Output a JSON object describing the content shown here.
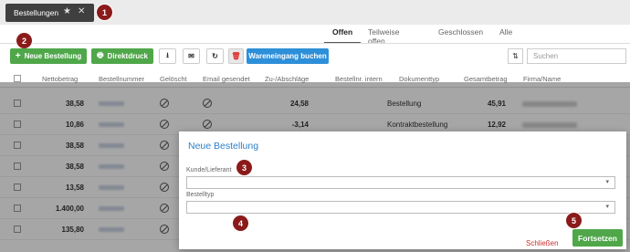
{
  "window": {
    "tab_label": "Bestellungen",
    "star": "★",
    "close": "✕"
  },
  "badges": [
    "1",
    "2",
    "3",
    "4",
    "5"
  ],
  "view_tabs": [
    "Offen",
    "Teilweise offen",
    "Geschlossen",
    "Alle"
  ],
  "toolbar": {
    "new_order": "Neue Bestellung",
    "direct_print": "Direktdruck",
    "goods_receipt": "Wareneingang buchen",
    "search_placeholder": "Suchen"
  },
  "table": {
    "headers": [
      "Nettobetrag",
      "Bestellnummer",
      "Gelöscht",
      "Email gesendet",
      "Zu-/Abschläge",
      "Bestellnr. intern",
      "Dokumenttyp",
      "Gesamtbetrag",
      "Firma/Name"
    ],
    "rows": [
      {
        "netto": "38,58",
        "zu": "24,58",
        "typ": "Bestellung",
        "gesamt": "45,91"
      },
      {
        "netto": "10,86",
        "zu": "-3,14",
        "typ": "Kontraktbestellung",
        "gesamt": "12,92"
      },
      {
        "netto": "38,58",
        "zu": "",
        "typ": "",
        "gesamt": ""
      },
      {
        "netto": "38,58",
        "zu": "",
        "typ": "",
        "gesamt": ""
      },
      {
        "netto": "13,58",
        "zu": "",
        "typ": "",
        "gesamt": ""
      },
      {
        "netto": "1.400,00",
        "zu": "",
        "typ": "",
        "gesamt": ""
      },
      {
        "netto": "135,80",
        "zu": "",
        "typ": "",
        "gesamt": ""
      }
    ]
  },
  "modal": {
    "title": "Neue Bestellung",
    "field1_label": "Kunde/Lieferant",
    "field2_label": "Bestelltyp",
    "cancel": "Schließen",
    "confirm": "Fortsetzen"
  }
}
